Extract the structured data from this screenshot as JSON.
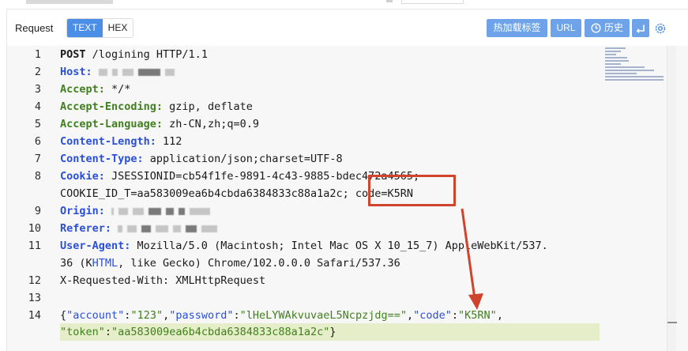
{
  "toolbar": {
    "title": "Request",
    "format_tabs": [
      "TEXT",
      "HEX"
    ],
    "active_tab": "TEXT",
    "hotload_label": "热加载标签",
    "url_label": "URL",
    "history_label": "历史"
  },
  "colors": {
    "accent": "#4a8ee8",
    "button": "#6ea3ea",
    "header_key": "#2a4fd8",
    "header_key_alt": "#41801e",
    "annotation": "#d0432d",
    "highlight_line": "#e6edc9"
  },
  "icons": [
    "history-clock-icon",
    "enter-icon",
    "settings-gear-icon"
  ],
  "request": {
    "lines": [
      {
        "n": "1",
        "method": "POST",
        "path": " /logining HTTP/1.1"
      },
      {
        "n": "2",
        "key": "Host:",
        "value": ""
      },
      {
        "n": "3",
        "key": "Accept:",
        "value": " */*"
      },
      {
        "n": "4",
        "key": "Accept-Encoding:",
        "value": " gzip, deflate"
      },
      {
        "n": "5",
        "key": "Accept-Language:",
        "value": " zh-CN,zh;q=0.9"
      },
      {
        "n": "6",
        "key": "Content-Length:",
        "value": " 112"
      },
      {
        "n": "7",
        "key": "Content-Type:",
        "value": " application/json;charset=UTF-8"
      },
      {
        "n": "8",
        "key": "Cookie:",
        "value": " JSESSIONID=cb54f1fe-9891-4c43-9885-bdec472a4565;",
        "cont": "COOKIE_ID_T=aa583009ea6b4cbda6384833c88a1a2c; ",
        "cont_tail": "code=K5RN"
      },
      {
        "n": "9",
        "key": "Origin:",
        "value": ""
      },
      {
        "n": "10",
        "key": "Referer:",
        "value": ""
      },
      {
        "n": "11",
        "key": "User-Agent:",
        "value": " Mozilla/5.0 (Macintosh; Intel Mac OS X 10_15_7) AppleWebKit/537.",
        "cont_a": "36 (K",
        "cont_b": "HTML",
        "cont_c": ", like Gecko) Chrome/102.0.0.0 Safari/537.36"
      },
      {
        "n": "12",
        "plain": "X-Requested-With: XMLHttpRequest"
      },
      {
        "n": "13",
        "plain": ""
      },
      {
        "n": "14"
      }
    ],
    "body": {
      "open": "{",
      "k_account": "\"account\"",
      "v_account": "\"123\"",
      "k_password": "\"password\"",
      "v_password": "\"lHeLYWAkvuvaeL5Ncpzjdg==\"",
      "k_code": "\"code\"",
      "v_code": "\"K5RN\"",
      "k_token": "\"token\"",
      "v_token": "\"aa583009ea6b4cbda6384833c88a1a2c\"",
      "close": "}"
    }
  }
}
